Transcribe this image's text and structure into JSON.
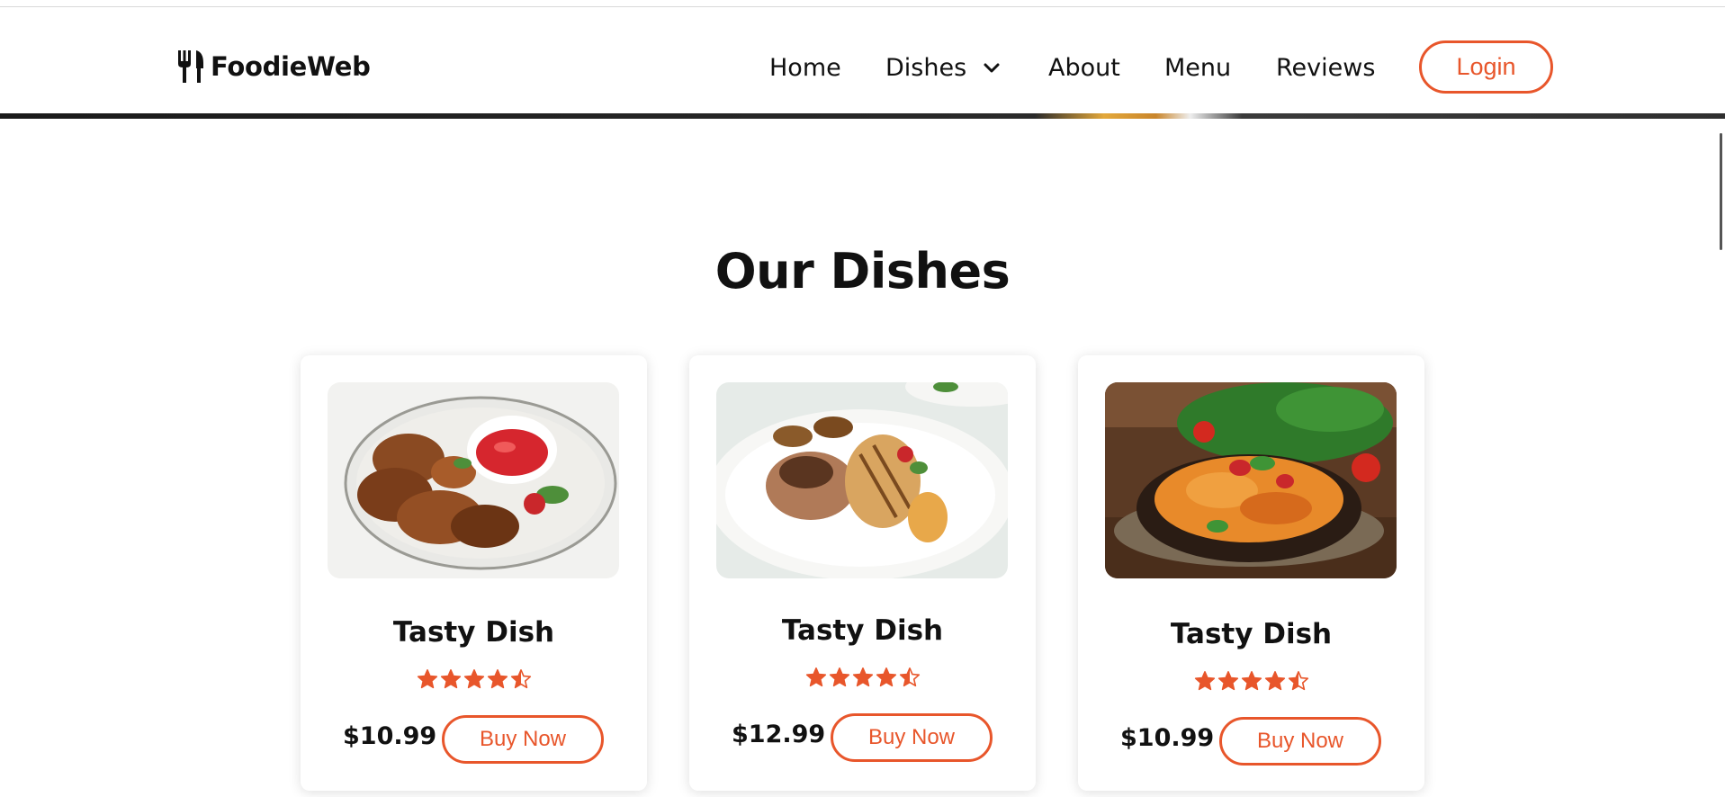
{
  "brand": {
    "name": "FoodieWeb",
    "logo_icon": "fork-knife-icon"
  },
  "nav": {
    "items": [
      {
        "label": "Home"
      },
      {
        "label": "Dishes",
        "icon": "chevron-down-icon"
      },
      {
        "label": "About"
      },
      {
        "label": "Menu"
      },
      {
        "label": "Reviews"
      }
    ],
    "login_label": "Login"
  },
  "colors": {
    "accent": "#e8562b",
    "text": "#111111",
    "background": "#ffffff"
  },
  "section": {
    "title": "Our Dishes"
  },
  "dishes": [
    {
      "image": "grilled-chicken-wings-image",
      "title": "Tasty Dish",
      "rating": 4.5,
      "price": "$10.99",
      "button": "Buy Now"
    },
    {
      "image": "grilled-chicken-steak-image",
      "title": "Tasty Dish",
      "rating": 4.5,
      "price": "$12.99",
      "button": "Buy Now"
    },
    {
      "image": "penne-pasta-image",
      "title": "Tasty Dish",
      "rating": 4.5,
      "price": "$10.99",
      "button": "Buy Now"
    }
  ]
}
